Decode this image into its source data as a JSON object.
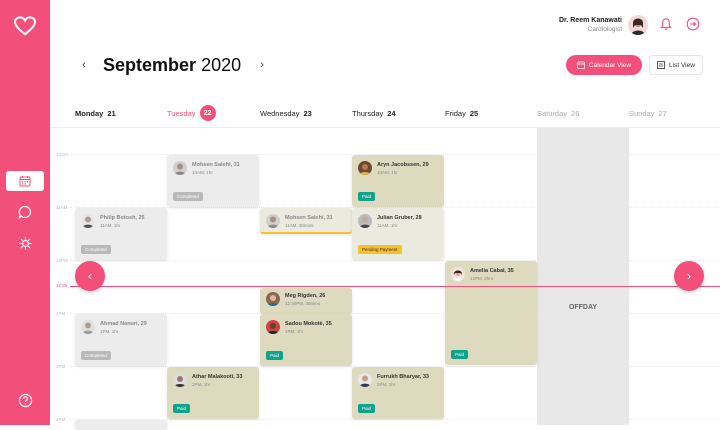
{
  "user": {
    "name": "Dr. Reem Kanawati",
    "role": "Cardiologist"
  },
  "header": {
    "month_name": "September",
    "year": "2020",
    "calendar_view_label": "Calendar View",
    "list_view_label": "List View"
  },
  "days": [
    {
      "name": "Monday",
      "num": "21"
    },
    {
      "name": "Tuesday",
      "num": "22",
      "today": true
    },
    {
      "name": "Wednesday",
      "num": "23"
    },
    {
      "name": "Thursday",
      "num": "24"
    },
    {
      "name": "Friday",
      "num": "25"
    },
    {
      "name": "Saturday",
      "num": "26",
      "off": true
    },
    {
      "name": "Sunday",
      "num": "27",
      "off": true
    }
  ],
  "hours": [
    "10AM",
    "11AM",
    "12PM",
    "1PM",
    "2PM",
    "3PM"
  ],
  "current_time": "12:36",
  "offday_label": "OFFDAY",
  "appointments": {
    "mohsen_tue": {
      "name": "Mohsen Salehi, 31",
      "time": "10AM, 1hr",
      "status": "Completed"
    },
    "aryn": {
      "name": "Aryn Jacobssen, 29",
      "time": "10AM, 1hr",
      "status": "Paid"
    },
    "philip": {
      "name": "Philip Botosh, 25",
      "time": "11AM, 1hr",
      "status": "Completed"
    },
    "mohsen_wed": {
      "name": "Mohsen Salehi, 31",
      "time": "11AM, 30mins"
    },
    "julian": {
      "name": "Julian Gruber, 28",
      "time": "11AM, 1hr",
      "status": "Pending Payment"
    },
    "amelia": {
      "name": "Amelia Cabal, 35",
      "time": "12PM, 2hrs",
      "status": "Paid"
    },
    "meg": {
      "name": "Meg Rigden, 26",
      "time": "12:30PM, 30mins"
    },
    "sadou": {
      "name": "Sadou Mokotè, 35",
      "time": "1PM, 1hr",
      "status": "Paid"
    },
    "ahmad": {
      "name": "Ahmad Nanuri, 29",
      "time": "1PM, 1hr",
      "status": "Completed"
    },
    "athar": {
      "name": "Athar Malakooti, 33",
      "time": "2PM, 1hr",
      "status": "Paid"
    },
    "furrukh": {
      "name": "Furrukh Bharyar, 33",
      "time": "2PM, 1hr",
      "status": "Paid"
    }
  },
  "colors": {
    "accent": "#f2507b",
    "paid": "#10a28a",
    "pending": "#f8bf2c",
    "completed": "#b9b9b9"
  }
}
